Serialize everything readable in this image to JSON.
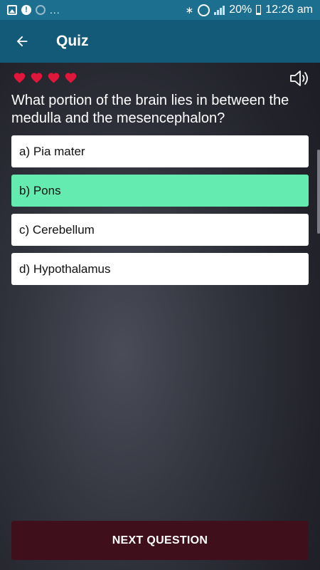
{
  "status_bar": {
    "left_more": "...",
    "battery": "20%",
    "time": "12:26 am",
    "icons": [
      "image-icon",
      "alert-icon",
      "sync-icon",
      "bluetooth-icon",
      "alarm-icon",
      "signal-icon",
      "battery-icon"
    ]
  },
  "app_bar": {
    "title": "Quiz",
    "back_icon": "arrow-left-icon",
    "color": "#135a78"
  },
  "lives": {
    "count": 4,
    "icon": "heart-icon",
    "color": "#e0173a"
  },
  "speaker_icon": "speaker-icon",
  "question": {
    "text": "What portion of the brain lies in between the medulla and the mesencephalon?"
  },
  "options": [
    {
      "label": "a) Pia mater",
      "state": "default"
    },
    {
      "label": "b) Pons",
      "state": "correct"
    },
    {
      "label": "c) Cerebellum",
      "state": "default"
    },
    {
      "label": "d) Hypothalamus",
      "state": "default"
    }
  ],
  "colors": {
    "correct": "#64ebb0",
    "next_button": "#3f0f1c"
  },
  "next_button": {
    "label": "NEXT QUESTION"
  }
}
